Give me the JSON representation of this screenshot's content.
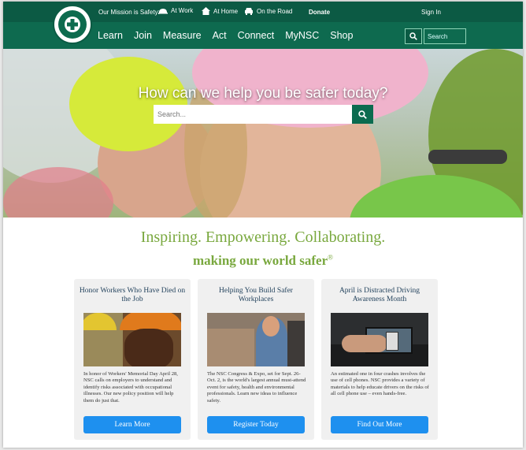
{
  "topbar": {
    "mission": "Our Mission is Safety:",
    "contexts": [
      {
        "label": "At Work",
        "icon": "hardhat-icon"
      },
      {
        "label": "At Home",
        "icon": "home-icon"
      },
      {
        "label": "On the Road",
        "icon": "car-icon"
      }
    ],
    "donate": "Donate",
    "signin": "Sign In"
  },
  "logo": {
    "alt": "National Safety Council"
  },
  "nav": {
    "items": [
      "Learn",
      "Join",
      "Measure",
      "Act",
      "Connect",
      "MyNSC",
      "Shop"
    ],
    "search_placeholder": "Search"
  },
  "hero": {
    "title": "How can we help you be safer today?",
    "search_placeholder": "Search..."
  },
  "taglines": {
    "line1": "Inspiring. Empowering. Collaborating.",
    "line2": "making our world safer",
    "mark": "®"
  },
  "cards": [
    {
      "title": "Honor Workers Who Have Died on the Job",
      "text": "In honor of Workers' Memorial Day April 28, NSC calls on employers to understand and identify risks associated with occupational illnesses. Our new policy position will help them do just that.",
      "button": "Learn More"
    },
    {
      "title": "Helping You Build Safer Workplaces",
      "text": "The NSC Congress & Expo, set for Sept. 26-Oct. 2, is the world's largest annual must-attend event for safety, health and environmental professionals. Learn new ideas to influence safety.",
      "button": "Register Today"
    },
    {
      "title": "April is Distracted Driving Awareness Month",
      "text": "An estimated one in four crashes involves the use of cell phones. NSC provides a variety of materials to help educate drivers on the risks of all cell phone use – even hands-free.",
      "button": "Find Out More"
    }
  ],
  "colors": {
    "brand_green": "#0e6a4f",
    "tagline_green": "#79a83e",
    "button_blue": "#1e90ef"
  }
}
